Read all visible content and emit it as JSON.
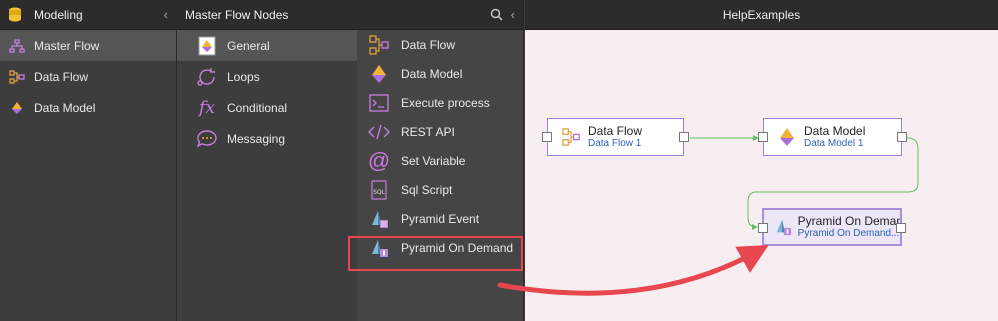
{
  "left_panel": {
    "title": "Modeling",
    "items": [
      {
        "label": "Master Flow",
        "icon": "master-flow-icon"
      },
      {
        "label": "Data Flow",
        "icon": "data-flow-icon"
      },
      {
        "label": "Data Model",
        "icon": "data-model-icon"
      }
    ]
  },
  "middle_panel": {
    "title": "Master Flow Nodes",
    "categories": [
      {
        "label": "General",
        "icon": "general-icon"
      },
      {
        "label": "Loops",
        "icon": "loops-icon"
      },
      {
        "label": "Conditional",
        "icon": "conditional-icon"
      },
      {
        "label": "Messaging",
        "icon": "messaging-icon"
      }
    ],
    "nodes": [
      {
        "label": "Data Flow",
        "icon": "data-flow-icon"
      },
      {
        "label": "Data Model",
        "icon": "data-model-icon"
      },
      {
        "label": "Execute process",
        "icon": "terminal-icon"
      },
      {
        "label": "REST API",
        "icon": "code-icon"
      },
      {
        "label": "Set Variable",
        "icon": "at-icon"
      },
      {
        "label": "Sql Script",
        "icon": "sql-icon"
      },
      {
        "label": "Pyramid Event",
        "icon": "pyramid-event-icon"
      },
      {
        "label": "Pyramid On Demand",
        "icon": "pyramid-on-demand-icon"
      }
    ],
    "conditional_glyph": "fx"
  },
  "canvas": {
    "title": "HelpExamples",
    "cards": [
      {
        "title": "Data Flow",
        "subtitle": "Data Flow 1"
      },
      {
        "title": "Data Model",
        "subtitle": "Data Model 1"
      },
      {
        "title": "Pyramid On Demand",
        "subtitle": "Pyramid On Demand..."
      }
    ]
  },
  "colors": {
    "accent_purple": "#a98fd8",
    "highlight_red": "#e8474f",
    "connector_green": "#5cc45c",
    "link_blue": "#2b63b5"
  }
}
